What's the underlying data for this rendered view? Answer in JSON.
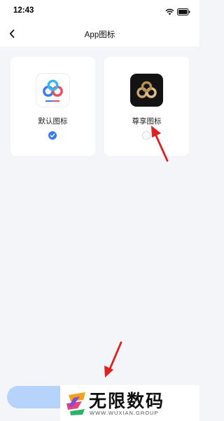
{
  "status_bar": {
    "time": "12:43"
  },
  "nav": {
    "title": "App图标"
  },
  "icons": [
    {
      "label": "默认图标",
      "selected": true
    },
    {
      "label": "尊享图标",
      "selected": false
    }
  ],
  "watermark": {
    "title": "无限数码",
    "subtitle": "WWW.WUXIAN.GROUP"
  },
  "colors": {
    "accent": "#3a7bf2",
    "button": "#b5d3fb",
    "background": "#f4f5f9",
    "annotation_arrow": "#e02020"
  }
}
